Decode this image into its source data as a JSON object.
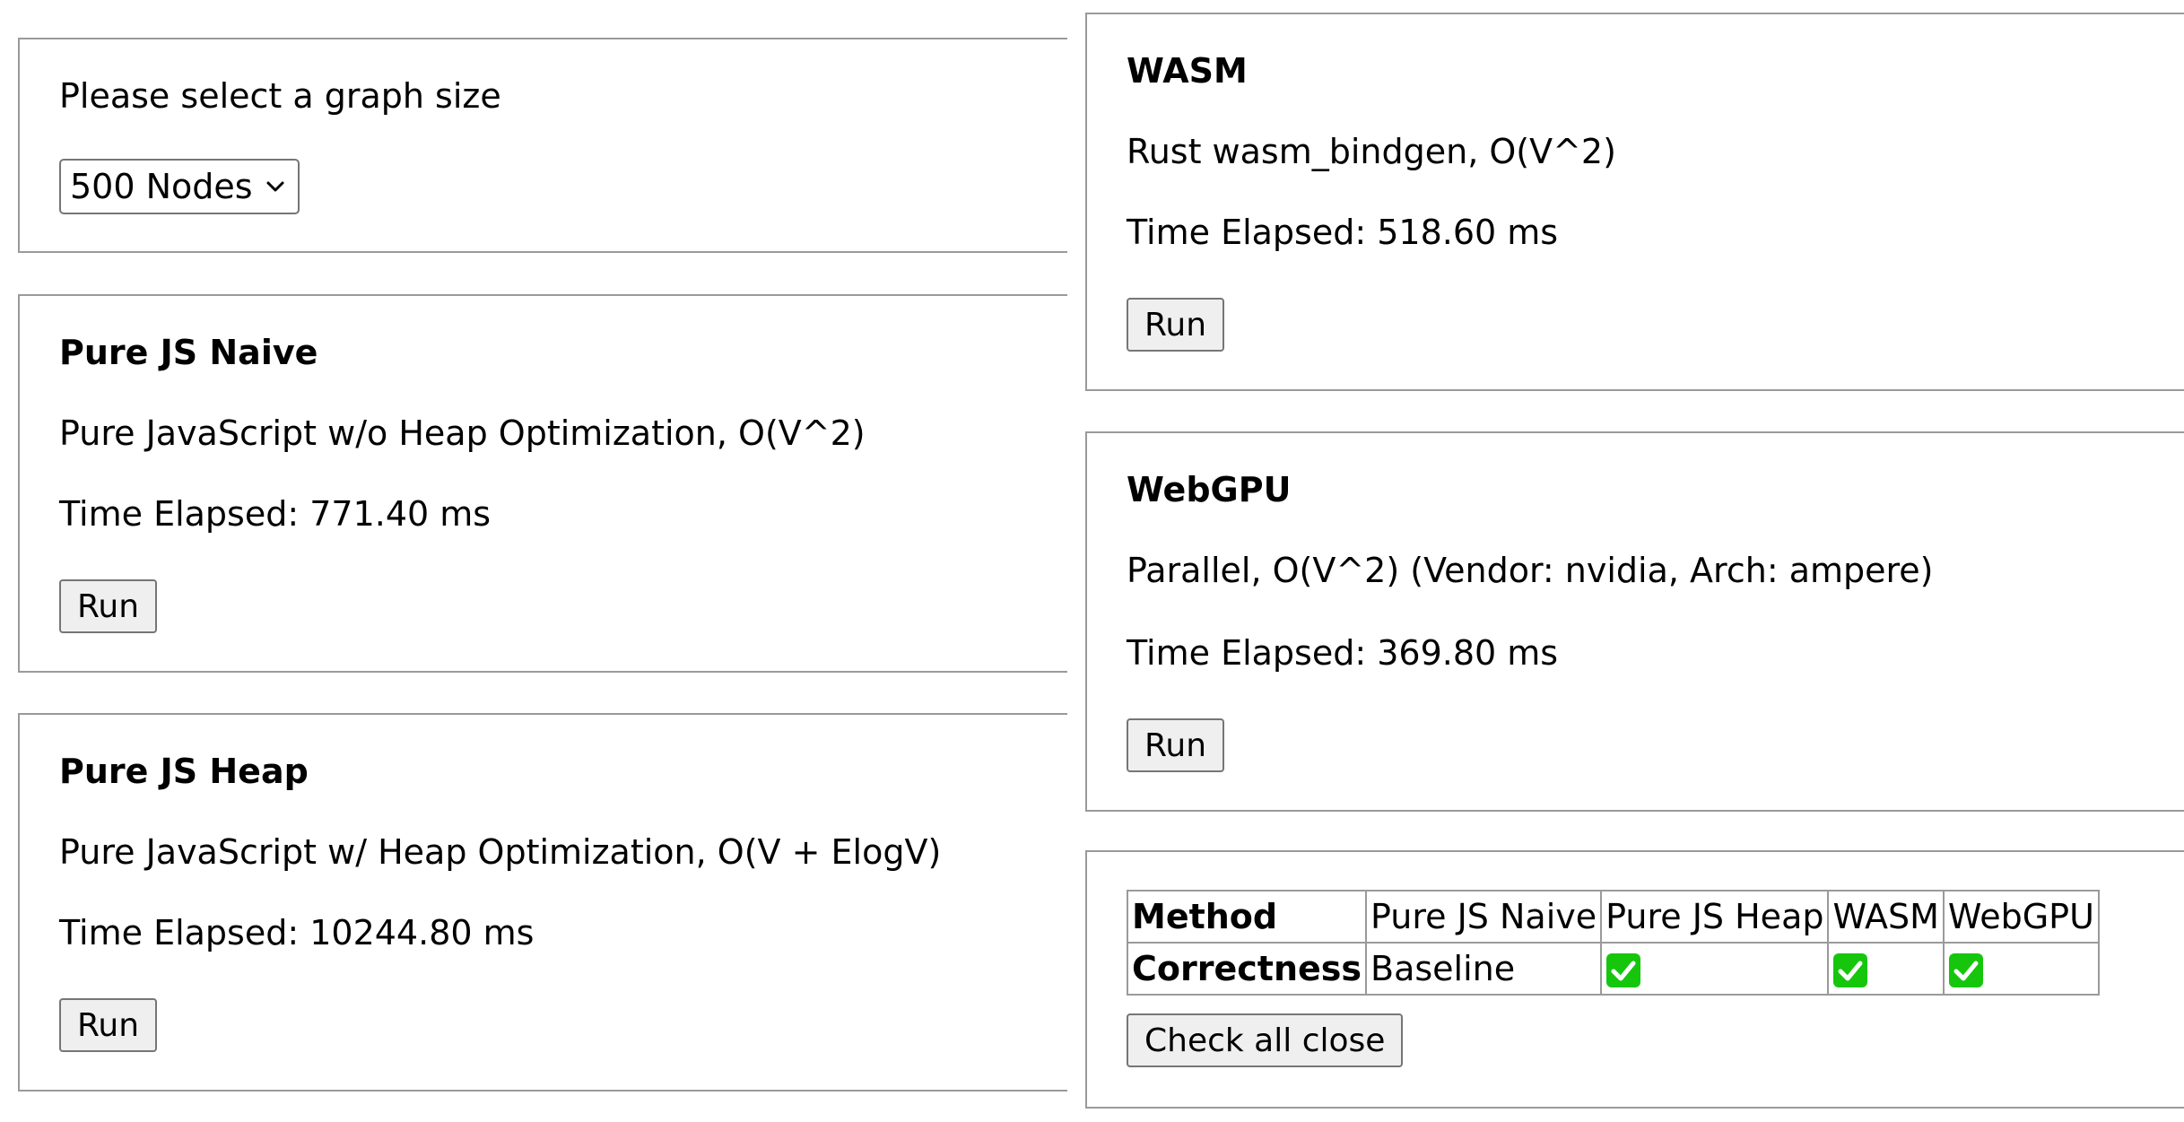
{
  "size_panel": {
    "prompt": "Please select a graph size",
    "selected": "500 Nodes"
  },
  "methods": {
    "naive": {
      "title": "Pure JS Naive",
      "description": "Pure JavaScript w/o Heap Optimization, O(V^2)",
      "time": "Time Elapsed: 771.40 ms",
      "run_label": "Run"
    },
    "heap": {
      "title": "Pure JS Heap",
      "description": "Pure JavaScript w/ Heap Optimization, O(V + ElogV)",
      "time": "Time Elapsed: 10244.80 ms",
      "run_label": "Run"
    },
    "wasm": {
      "title": "WASM",
      "description": "Rust wasm_bindgen, O(V^2)",
      "time": "Time Elapsed: 518.60 ms",
      "run_label": "Run"
    },
    "webgpu": {
      "title": "WebGPU",
      "description": "Parallel, O(V^2) (Vendor: nvidia, Arch: ampere)",
      "time": "Time Elapsed: 369.80 ms",
      "run_label": "Run"
    }
  },
  "results_table": {
    "header_row_label": "Method",
    "columns": [
      "Pure JS Naive",
      "Pure JS Heap",
      "WASM",
      "WebGPU"
    ],
    "correctness_label": "Correctness",
    "correctness": {
      "naive": "Baseline",
      "heap": "check-mark-icon",
      "wasm": "check-mark-icon",
      "webgpu": "check-mark-icon"
    },
    "check_color": "#16c60c",
    "check_button_label": "Check all close"
  }
}
